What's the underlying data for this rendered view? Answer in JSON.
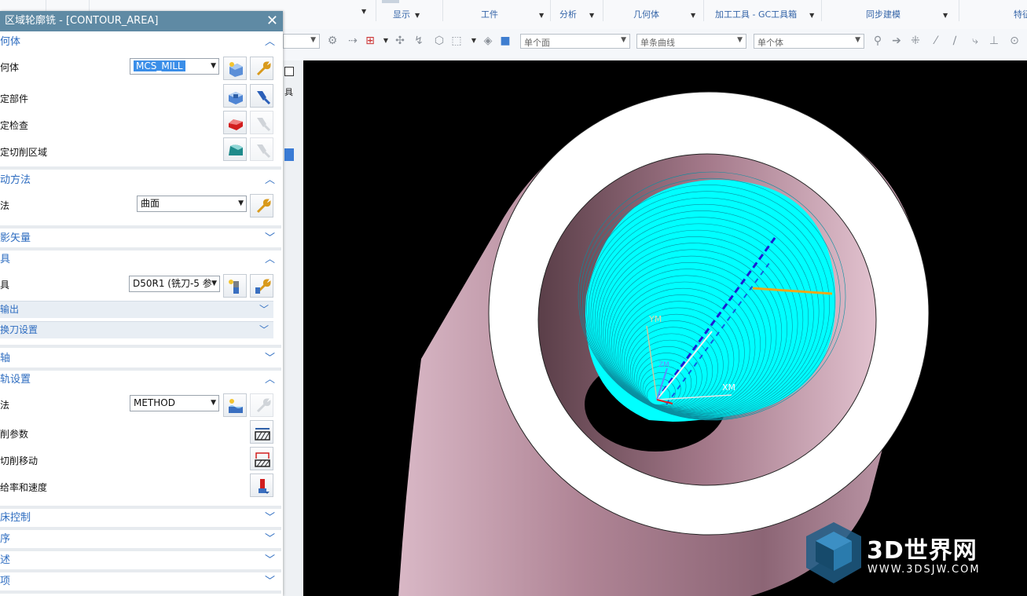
{
  "ribbon": {
    "groups": [
      {
        "label": "显示"
      },
      {
        "label": "工件"
      },
      {
        "label": "分析"
      },
      {
        "label": "几何体"
      },
      {
        "label": "加工工具 - GC工具箱"
      },
      {
        "label": "同步建模"
      },
      {
        "label": "特征"
      }
    ]
  },
  "toolbar": {
    "filter1": "单个面",
    "filter2": "单条曲线",
    "filter3": "单个体"
  },
  "dialog": {
    "title": "区域轮廓铣 - [CONTOUR_AREA]",
    "sections": {
      "geometry": "何体",
      "drive": "动方法",
      "projection": "影矢量",
      "tool": "具",
      "tool_output": "输出",
      "tool_change": "换刀设置",
      "axis": "轴",
      "path": "轨设置",
      "machine": "床控制",
      "program": "序",
      "description": "述",
      "options": "项"
    },
    "rows": {
      "geometry_label": "何体",
      "geometry_value": "MCS_MILL",
      "part_label": "定部件",
      "check_label": "定检查",
      "cut_area_label": "定切削区域",
      "method_label": "法",
      "method_value": "曲面",
      "tool_label": "具",
      "tool_value": "D50R1 (铣刀-5 参",
      "path_method_label": "法",
      "path_method_value": "METHOD",
      "cut_params_label": "削参数",
      "non_cut_label": "切削移动",
      "feeds_label": "给率和速度"
    }
  },
  "viewport": {
    "xm_label": "XM",
    "ym_label": "YM",
    "zm_label": "ZM"
  },
  "watermark": {
    "brand": "3D世界网",
    "url": "WWW.3DSJW.COM"
  },
  "colors": {
    "toolpath": "#00ffff",
    "part_outer": "#c497a9",
    "part_top": "#ffffff",
    "title_bar": "#5f8aa4",
    "section_text": "#2d6cc0"
  }
}
